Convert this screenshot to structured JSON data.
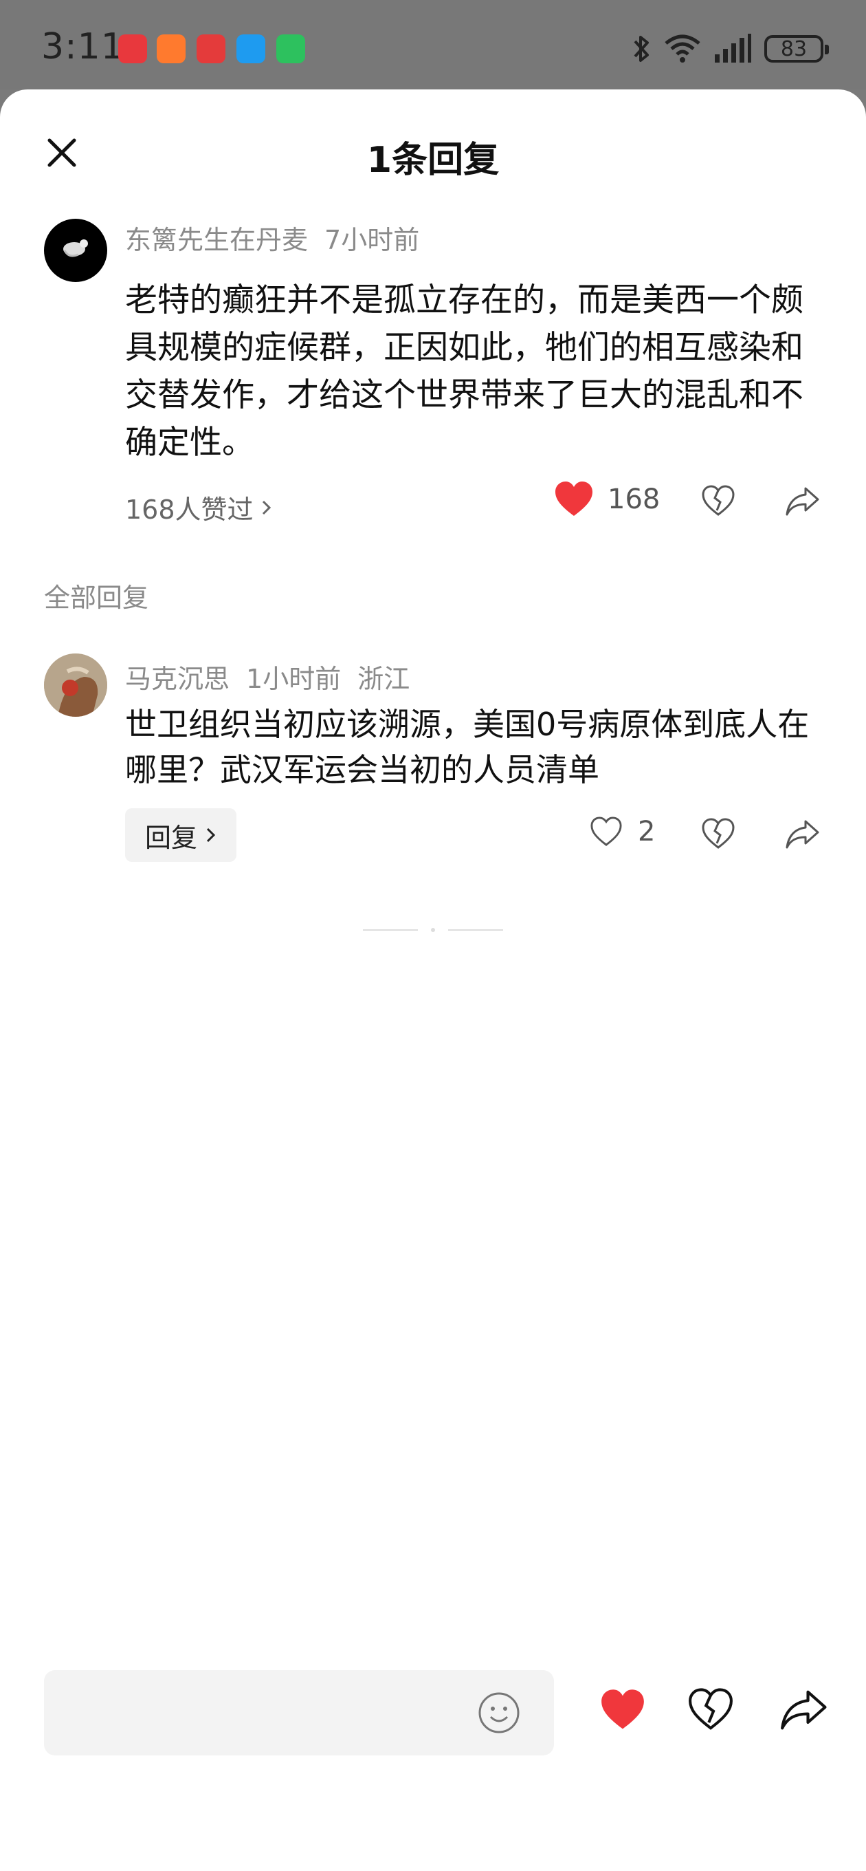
{
  "status_bar": {
    "time": "3:11",
    "battery": "83",
    "app_icons": [
      "huawei-appgallery-icon",
      "kuaishou-icon",
      "news-icon",
      "message-icon",
      "wechat-icon"
    ],
    "system_icons": [
      "bluetooth-icon",
      "wifi-icon",
      "signal-icon",
      "battery-icon"
    ]
  },
  "header": {
    "title": "1条回复"
  },
  "main_comment": {
    "author": "东篱先生在丹麦",
    "time": "7小时前",
    "text": "老特的癫狂并不是孤立存在的，而是美西一个颇具规模的症候群，正因如此，牠们的相互感染和交替发作，才给这个世界带来了巨大的混乱和不确定性。",
    "likes_link": "168人赞过",
    "like_count": "168",
    "liked": true
  },
  "replies_section": {
    "label": "全部回复"
  },
  "reply": {
    "author": "马克沉思",
    "time": "1小时前",
    "location": "浙江",
    "text": "世卫组织当初应该溯源，美国0号病原体到底人在哪里？武汉军运会当初的人员清单",
    "like_count": "2",
    "reply_button": "回复"
  },
  "bottom_bar": {
    "input_placeholder": ""
  },
  "colors": {
    "accent_red": "#f0373c",
    "text_gray": "#8a8a8a"
  }
}
